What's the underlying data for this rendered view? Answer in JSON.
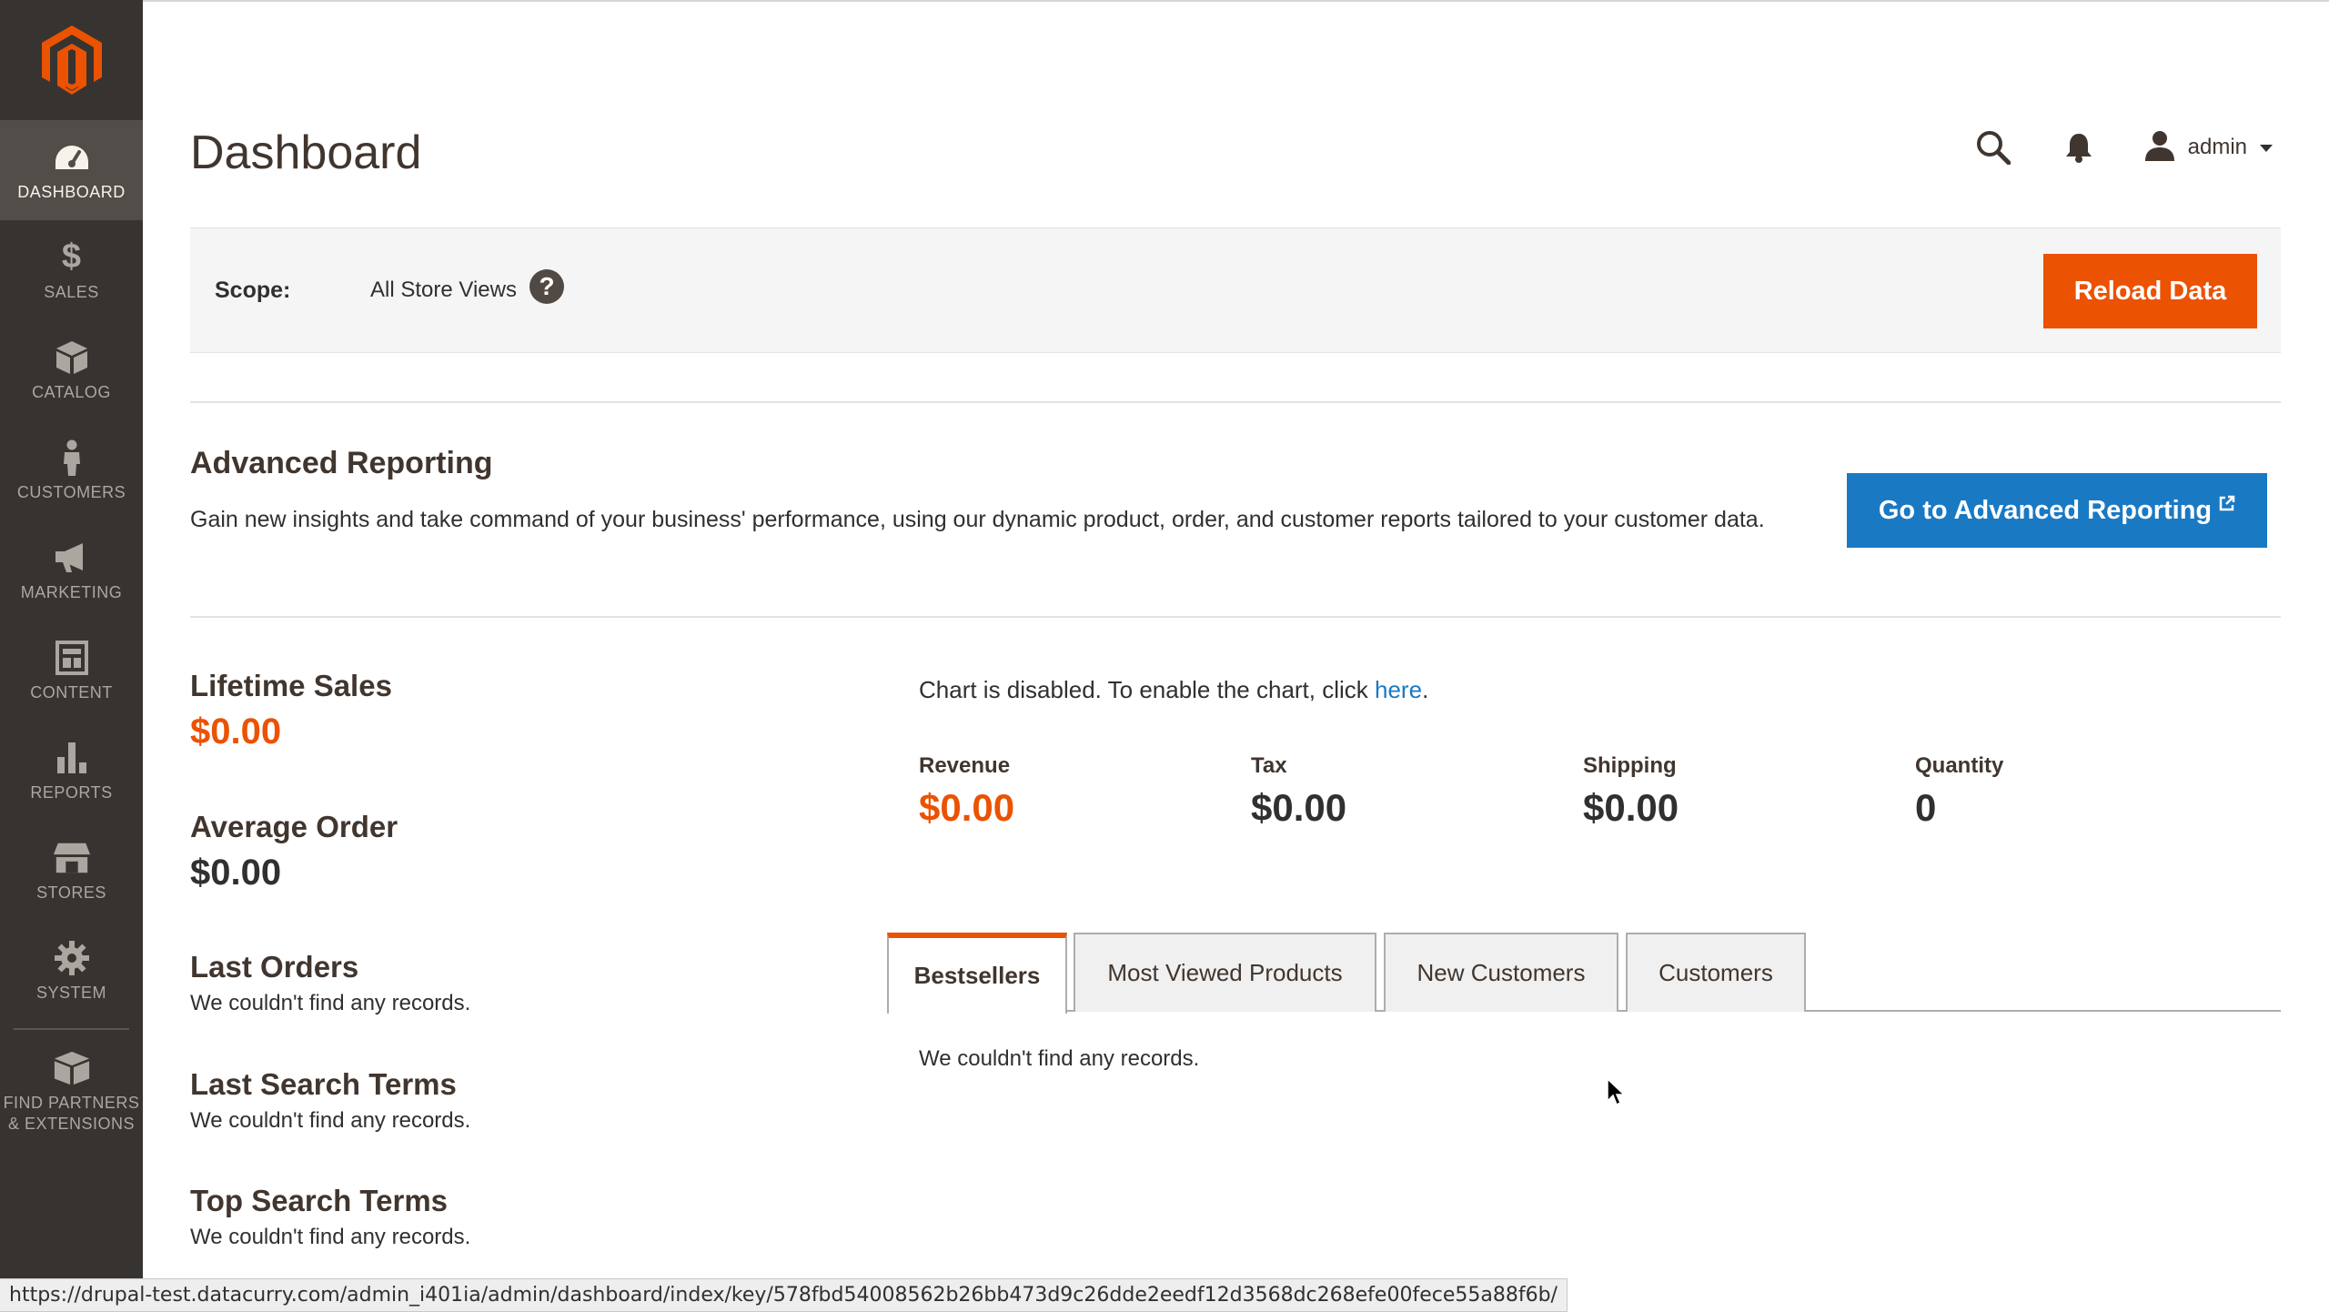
{
  "sidebar": {
    "items": [
      {
        "label": "DASHBOARD",
        "icon": "dashboard-icon"
      },
      {
        "label": "SALES",
        "icon": "dollar-icon"
      },
      {
        "label": "CATALOG",
        "icon": "box-icon"
      },
      {
        "label": "CUSTOMERS",
        "icon": "person-icon"
      },
      {
        "label": "MARKETING",
        "icon": "megaphone-icon"
      },
      {
        "label": "CONTENT",
        "icon": "layout-icon"
      },
      {
        "label": "REPORTS",
        "icon": "bar-chart-icon"
      },
      {
        "label": "STORES",
        "icon": "store-icon"
      },
      {
        "label": "SYSTEM",
        "icon": "gear-icon"
      },
      {
        "label_line1": "FIND PARTNERS",
        "label_line2": "& EXTENSIONS",
        "icon": "extensions-box-icon"
      }
    ]
  },
  "header": {
    "title": "Dashboard",
    "user": "admin"
  },
  "scope": {
    "label": "Scope:",
    "value": "All Store Views",
    "reload_label": "Reload Data"
  },
  "advanced_reporting": {
    "title": "Advanced Reporting",
    "text": "Gain new insights and take command of your business' performance, using our dynamic product, order, and customer reports tailored to your customer data.",
    "button_label": "Go to Advanced Reporting"
  },
  "stats": {
    "lifetime_sales_title": "Lifetime Sales",
    "lifetime_sales_value": "$0.00",
    "average_order_title": "Average Order",
    "average_order_value": "$0.00",
    "last_orders_title": "Last Orders",
    "last_orders_empty": "We couldn't find any records.",
    "last_search_title": "Last Search Terms",
    "last_search_empty": "We couldn't find any records.",
    "top_search_title": "Top Search Terms",
    "top_search_empty": "We couldn't find any records."
  },
  "chart": {
    "message": "Chart is disabled. To enable the chart, click ",
    "link": "here",
    "period": "."
  },
  "totals": [
    {
      "label": "Revenue",
      "value": "$0.00"
    },
    {
      "label": "Tax",
      "value": "$0.00"
    },
    {
      "label": "Shipping",
      "value": "$0.00"
    },
    {
      "label": "Quantity",
      "value": "0"
    }
  ],
  "tabs": [
    {
      "label": "Bestsellers"
    },
    {
      "label": "Most Viewed Products"
    },
    {
      "label": "New Customers"
    },
    {
      "label": "Customers"
    }
  ],
  "tab_content": "We couldn't find any records.",
  "status_url": "https://drupal-test.datacurry.com/admin_i401ia/admin/dashboard/index/key/578fbd54008562b26bb473d9c26dde2eedf12d3568dc268efe00fece55a88f6b/",
  "colors": {
    "accent": "#eb5202",
    "link": "#1979c3",
    "sidebar": "#373330"
  }
}
